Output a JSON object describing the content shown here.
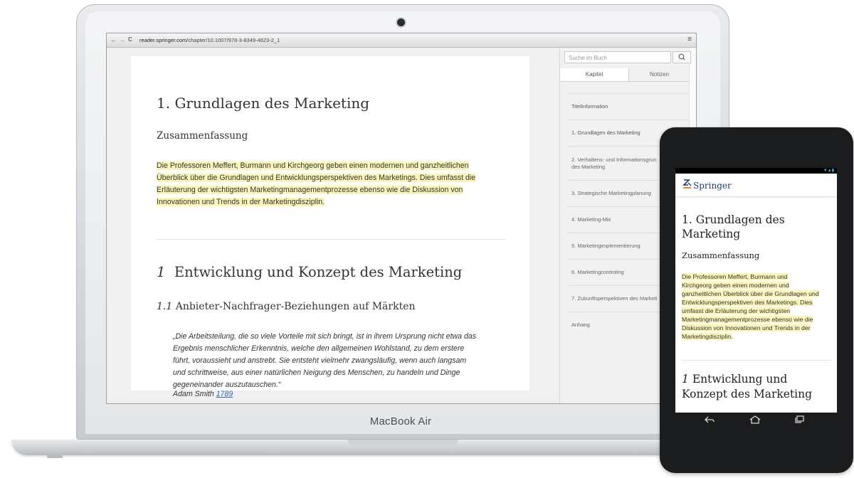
{
  "laptop": {
    "brand": "MacBook Air"
  },
  "browser": {
    "back_icon": "←",
    "forward_icon": "→",
    "reload_icon": "C",
    "url_host": "reader.springer.com",
    "url_path": "/chapter/10.1007/978-3-8349-4623-2_1",
    "menu_icon": "≡"
  },
  "sidebar": {
    "search_placeholder": "Suche im Buch",
    "tabs": [
      {
        "label": "Kapitel"
      },
      {
        "label": "Notizen"
      }
    ],
    "toc": [
      "TitelInformation",
      "1. Grundlagen des Marketing",
      "2. Verhaltens- und Informationsgrun\ndes Marketing",
      "3. Strategische Marketingplanung",
      "4. Marketing-Mix",
      "5. Marketingimplementierung",
      "6. Marketingcontroling",
      "7. Zukunftsperspektiven des Marketi",
      "Anhang"
    ]
  },
  "article": {
    "chapter_title": "1. Grundlagen des Marketing",
    "summary_heading": "Zusammenfassung",
    "abstract_lines": [
      "Die Professoren Meffert, Burmann und Kirchgeorg geben einen modernen und ganzheitlichen",
      "Überblick über die Grundlagen und Entwicklungsperspektiven des Marketings. Dies umfasst die",
      "Erläuterung der wichtigsten Marketingmanagementprozesse ebenso wie die Diskussion von",
      "Innovationen und Trends in der Marketingdisziplin."
    ],
    "section_number": "1",
    "section_title": "Entwicklung und Konzept des Marketing",
    "subsection_number": "1.1",
    "subsection_title": "Anbieter-Nachfrager-Beziehungen auf Märkten",
    "quote_lines": [
      "„Die Arbeitsteilung, die so viele Vorteile mit sich bringt, ist in ihrem Ursprung nicht etwa das",
      "Ergebnis menschlicher Erkenntnis, welche den allgemeinen Wohlstand, zu dem erstere",
      "führt, voraussieht und anstrebt. Sie entsteht vielmehr zwangsläufig, wenn auch langsam",
      "und schrittweise, aus einer natürlichen Neigung des Menschen, zu handeln und Dinge",
      "gegeneinander auszutauschen.“"
    ],
    "quote_author": "Adam Smith",
    "quote_year": "1789"
  },
  "tablet": {
    "logo_text": "Springer",
    "chapter_title": "1. Grundlagen des Marketing",
    "summary_heading": "Zusammenfassung",
    "abstract_lines": [
      "Die Professoren Meffert, Burmann und",
      "Kirchgeorg geben einen modernen und",
      "ganzheitlichen Überblick über die Grundlagen und",
      "Entwicklungsperspektiven des Marketings. Dies",
      "umfasst die Erläuterung der wichtigsten",
      "Marketingmanagementprozesse ebenso wie die",
      "Diskussion von Innovationen und Trends in der",
      "Marketingdisziplin."
    ],
    "section_number": "1",
    "section_title": "Entwicklung und Konzept des Marketing",
    "nav_icons": [
      "back-icon",
      "home-icon",
      "recent-apps-icon"
    ]
  },
  "colors": {
    "highlight": "#fbf6b8",
    "link": "#2b6cb0",
    "springer_blue": "#1f3a6b",
    "springer_orange": "#e8852b"
  }
}
